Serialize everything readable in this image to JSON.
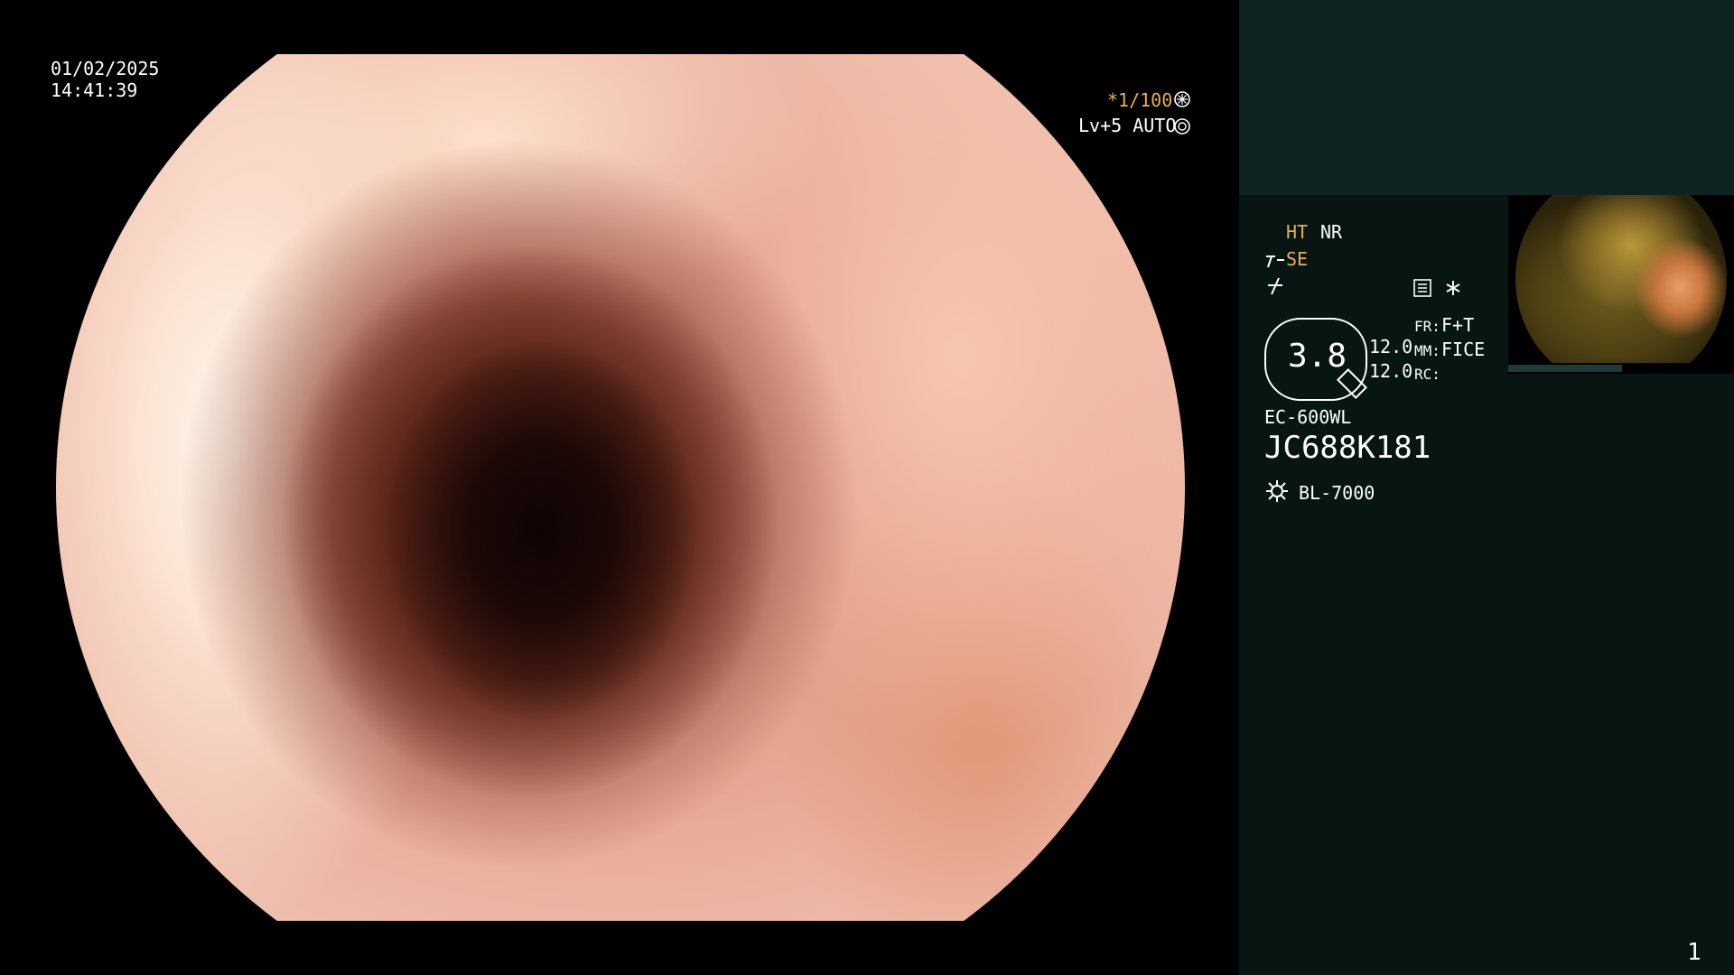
{
  "overlay": {
    "date": "01/02/2025",
    "time": "14:41:39",
    "shutter": "*1/100",
    "level": "Lv+5 AUTO"
  },
  "sidebar": {
    "ht_label": "HT",
    "nr_label": "NR",
    "se_label": "SE",
    "zoom_value": "3.8",
    "values": [
      "12.0",
      "12.0"
    ],
    "fr_label": "FR:",
    "fr_value": "F+T",
    "mm_label": "MM:",
    "mm_value": "FICE",
    "rc_label": "RC:",
    "scope_model": "EC-600WL",
    "serial": "JC688K181",
    "light_source": "BL-7000",
    "page_number": "1"
  },
  "icons": [
    "shutter-mode-icon",
    "auto-iris-icon",
    "enhancement-icon",
    "structure-icon",
    "memory-icon",
    "asterisk-icon",
    "light-source-icon"
  ],
  "colors": {
    "sidebar_bg": "#071613",
    "sidebar_top_bg": "#0f2422",
    "accent_orange": "#e8b04a"
  }
}
